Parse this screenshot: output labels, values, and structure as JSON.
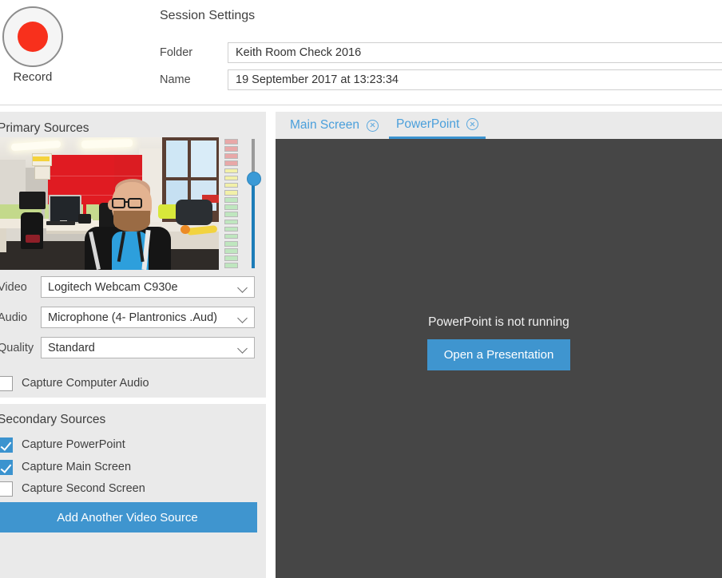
{
  "header": {
    "record_label": "Record",
    "session_settings_title": "Session Settings",
    "fields": [
      {
        "label": "Folder",
        "value": "Keith Room Check 2016",
        "placeholder": "Folder"
      },
      {
        "label": "Name",
        "value": "19 September 2017 at 13:23:34",
        "placeholder": "Name"
      }
    ]
  },
  "primary_sources": {
    "title": "Primary Sources",
    "dropdowns": [
      {
        "label": "Video",
        "value": "Logitech Webcam C930e"
      },
      {
        "label": "Audio",
        "value": "Microphone (4- Plantronics .Aud)"
      },
      {
        "label": "Quality",
        "value": "Standard"
      }
    ],
    "capture_computer_audio": {
      "label": "Capture Computer Audio",
      "checked": false
    },
    "audio_meter": {
      "segments": 18,
      "red_count": 4,
      "yellow_count": 4,
      "green_count": 10,
      "red_color": "#e8a8a8",
      "yellow_color": "#f2f0a8",
      "green_color": "#bfe6bf"
    },
    "volume_slider": {
      "value": 70,
      "accent_color": "#1d7cb8"
    }
  },
  "secondary_sources": {
    "title": "Secondary Sources",
    "checkboxes": [
      {
        "label": "Capture PowerPoint",
        "checked": true
      },
      {
        "label": "Capture Main Screen",
        "checked": true
      },
      {
        "label": "Capture Second Screen",
        "checked": false
      }
    ],
    "add_video_source_label": "Add Another Video Source"
  },
  "preview": {
    "tabs": [
      {
        "label": "Main Screen",
        "active": false
      },
      {
        "label": "PowerPoint",
        "active": true
      }
    ],
    "stage_message": "PowerPoint is not running",
    "open_presentation_label": "Open a Presentation",
    "stage_background": "#464646"
  },
  "colors": {
    "accent_blue": "#3f95cf",
    "link_blue": "#4a9fdb",
    "record_red": "#f8301c",
    "panel_gray": "#eaeaea"
  }
}
